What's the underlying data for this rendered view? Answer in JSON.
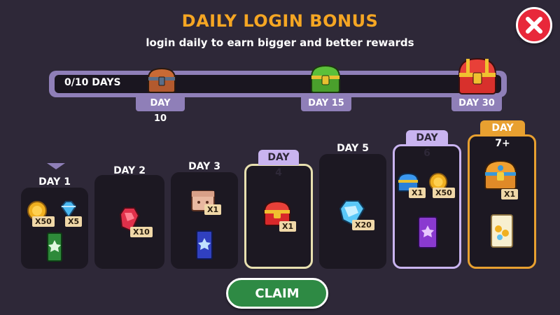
{
  "header": {
    "title": "DAILY LOGIN BONUS",
    "subtitle": "login daily to earn bigger and better rewards"
  },
  "progress": {
    "text": "0/10 DAYS",
    "milestones": [
      {
        "label": "DAY 10",
        "chest": "wooden-chest-icon"
      },
      {
        "label": "DAY 15",
        "chest": "green-chest-icon"
      },
      {
        "label": "DAY 30",
        "chest": "red-gold-chest-icon"
      }
    ]
  },
  "days": [
    {
      "label": "DAY 1",
      "rewards": [
        {
          "icon": "coin-icon",
          "qty": "X50"
        },
        {
          "icon": "gem-icon",
          "qty": "X5"
        },
        {
          "icon": "green-ticket-icon"
        }
      ]
    },
    {
      "label": "DAY 2",
      "rewards": [
        {
          "icon": "red-gem-icon",
          "qty": "X10"
        }
      ]
    },
    {
      "label": "DAY 3",
      "rewards": [
        {
          "icon": "gift-box-icon",
          "qty": "X1"
        },
        {
          "icon": "blue-ticket-icon"
        }
      ]
    },
    {
      "label": "DAY 4",
      "rewards": [
        {
          "icon": "red-chest-icon",
          "qty": "X1"
        }
      ]
    },
    {
      "label": "DAY 5",
      "rewards": [
        {
          "icon": "blue-gem-icon",
          "qty": "X20"
        }
      ]
    },
    {
      "label": "DAY 6",
      "rewards": [
        {
          "icon": "blue-chest-icon",
          "qty": "X1"
        },
        {
          "icon": "coin-icon",
          "qty": "X50"
        },
        {
          "icon": "purple-ticket-icon"
        }
      ]
    },
    {
      "label": "DAY 7+",
      "rewards": [
        {
          "icon": "golden-chest-icon",
          "qty": "X1"
        },
        {
          "icon": "gold-ticket-icon"
        }
      ]
    }
  ],
  "claim_label": "CLAIM",
  "colors": {
    "title": "#f5a623",
    "panel": "#1c1822",
    "accent": "#8f7fb8",
    "claim": "#2e8a44",
    "close": "#e8283a"
  }
}
